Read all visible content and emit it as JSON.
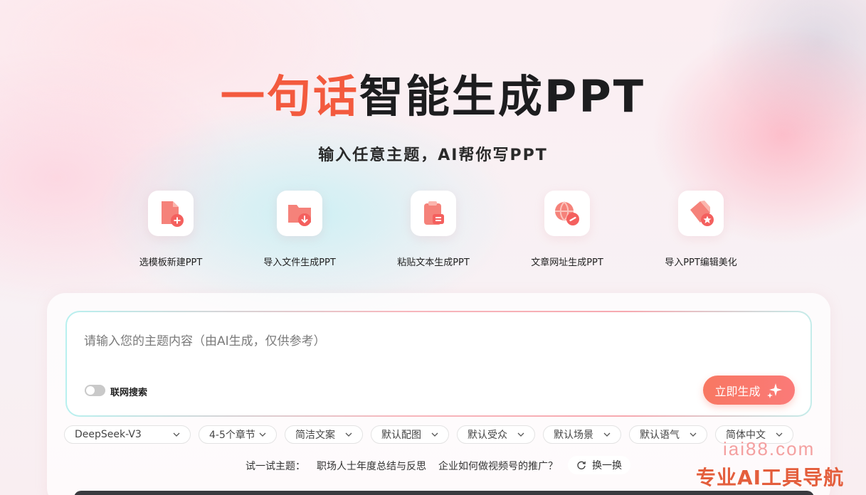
{
  "hero": {
    "title_accent": "一句话",
    "title_main": "智能生成PPT",
    "subtitle": "输入任意主题，AI帮你写PPT"
  },
  "tools": [
    {
      "label": "选模板新建PPT",
      "icon": "new-file-icon"
    },
    {
      "label": "导入文件生成PPT",
      "icon": "import-folder-icon"
    },
    {
      "label": "粘贴文本生成PPT",
      "icon": "paste-clipboard-icon"
    },
    {
      "label": "文章网址生成PPT",
      "icon": "web-link-icon"
    },
    {
      "label": "导入PPT编辑美化",
      "icon": "beautify-brush-icon"
    }
  ],
  "input": {
    "placeholder": "请输入您的主题内容（由AI生成，仅供参考）",
    "web_search_label": "联网搜索",
    "web_search_enabled": false,
    "generate_label": "立即生成"
  },
  "options": [
    "DeepSeek-V3",
    "4-5个章节",
    "简洁文案",
    "默认配图",
    "默认受众",
    "默认场景",
    "默认语气",
    "简体中文"
  ],
  "try": {
    "label": "试一试主题：",
    "topics": [
      "职场人士年度总结与反思",
      "企业如何做视频号的推广？"
    ],
    "refresh_label": "换一换"
  },
  "watermark": {
    "url": "iai88.com",
    "text": "专业AI工具导航"
  },
  "colors": {
    "accent": "#f35a3e",
    "button": "#f87862",
    "icon_red": "#f4605e"
  }
}
